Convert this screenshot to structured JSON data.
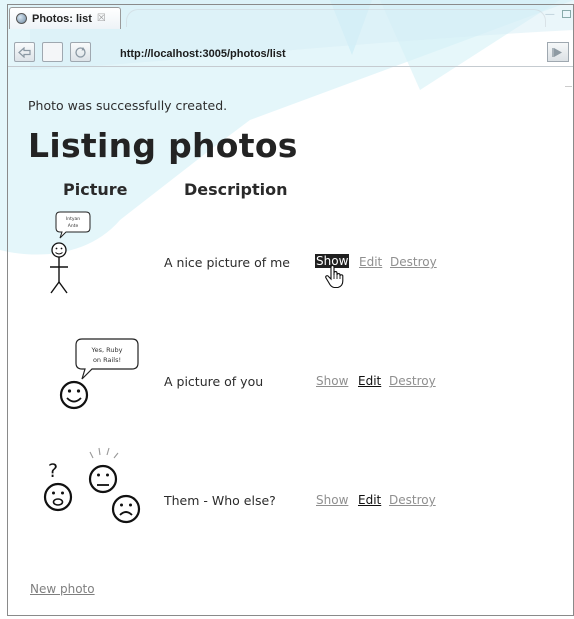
{
  "window": {
    "tab_title": "Photos: list",
    "tab_close": "☒",
    "url": "http://localhost:3005/photos/list"
  },
  "page": {
    "notice": "Photo was successfully created.",
    "heading": "Listing photos",
    "columns": [
      "Picture",
      "Description"
    ],
    "rows": [
      {
        "description": "A nice picture of me",
        "bubble_lines": [
          "Intyan",
          "Ante"
        ],
        "actions": {
          "show": "Show",
          "edit": "Edit",
          "destroy": "Destroy"
        }
      },
      {
        "description": "A picture of you",
        "bubble_lines": [
          "Yes, Ruby",
          "on Rails!"
        ],
        "actions": {
          "show": "Show",
          "edit": "Edit",
          "destroy": "Destroy"
        }
      },
      {
        "description": "Them - Who else?",
        "question_mark": "?",
        "actions": {
          "show": "Show",
          "edit": "Edit",
          "destroy": "Destroy"
        }
      }
    ],
    "new_link": "New photo"
  },
  "colors": {
    "watermark": "#cdeef6",
    "hover_bg": "#1f1f1f"
  },
  "icons": [
    "globe-icon",
    "back-icon",
    "forward-icon",
    "page-icon",
    "go-icon",
    "hand-cursor-icon"
  ]
}
